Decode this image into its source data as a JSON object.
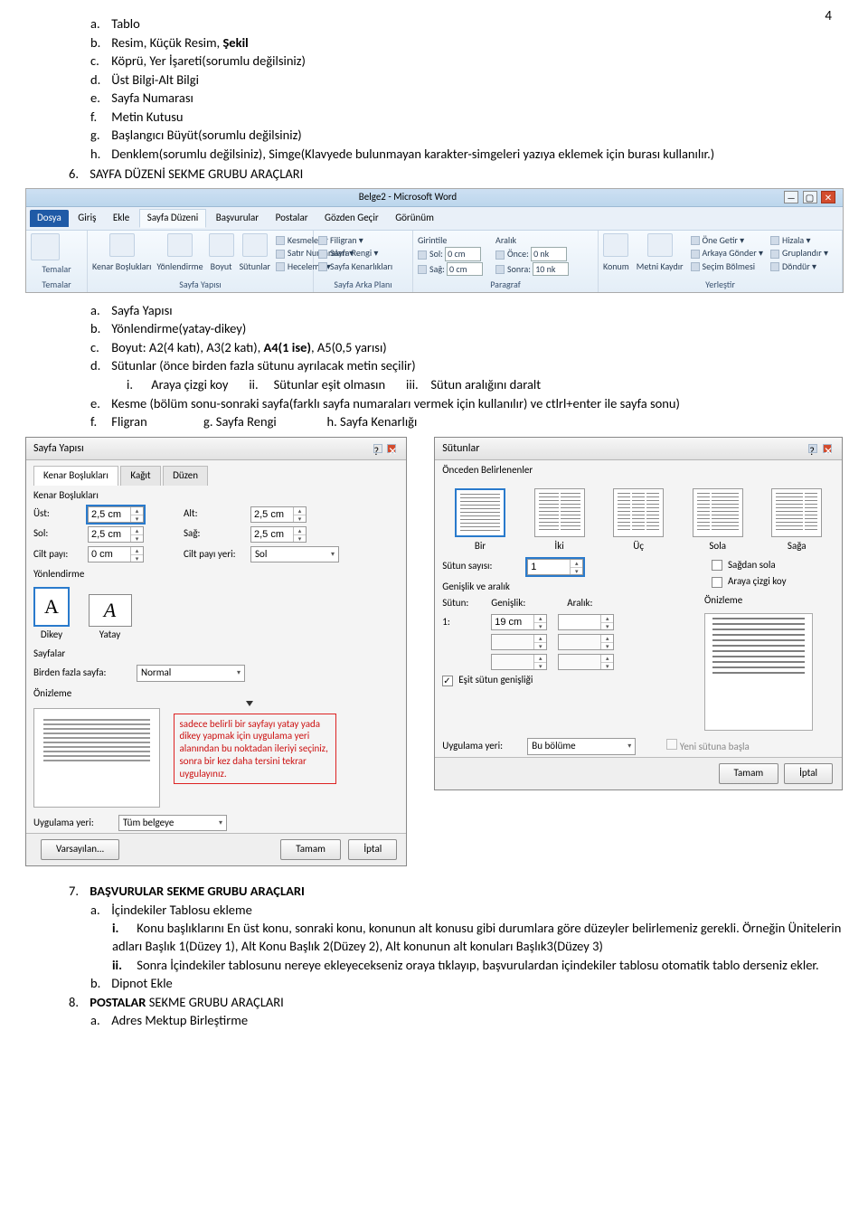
{
  "page_number": "4",
  "top": {
    "a": "Tablo",
    "b_prefix": "Resim, Küçük Resim, ",
    "b_bold": "Şekil",
    "c": "Köprü, Yer İşareti(sorumlu değilsiniz)",
    "d": "Üst Bilgi-Alt Bilgi",
    "e": "Sayfa Numarası",
    "f": "Metin Kutusu",
    "g": "Başlangıcı Büyüt(sorumlu değilsiniz)",
    "h": "Denklem(sorumlu değilsiniz), Simge(Klavyede bulunmayan karakter-simgeleri yazıya eklemek için burası kullanılır.)"
  },
  "sec6_prefix": "6.",
  "sec6_title": "SAYFA DÜZENİ SEKME GRUBU ARAÇLARI",
  "ribbon": {
    "win_title": "Belge2 - Microsoft Word",
    "tabs": {
      "file": "Dosya",
      "home": "Giriş",
      "insert": "Ekle",
      "layout": "Sayfa Düzeni",
      "refs": "Başvurular",
      "mail": "Postalar",
      "review": "Gözden Geçir",
      "view": "Görünüm"
    },
    "groups": {
      "temalar": {
        "lbl": "Temalar",
        "items": "Temalar"
      },
      "sayfa_yapisi": {
        "lbl": "Sayfa Yapısı",
        "kenar": "Kenar Boşlukları",
        "yonl": "Yönlendirme",
        "boyut": "Boyut",
        "sutun": "Sütunlar",
        "kesme": "Kesmeler",
        "satirno": "Satır Numaraları",
        "hece": "Heceleme"
      },
      "arka": {
        "lbl": "Sayfa Arka Planı",
        "filigran": "Filigran",
        "rengi": "Sayfa Rengi",
        "kenarlik": "Sayfa Kenarlıkları"
      },
      "paragraf": {
        "lbl": "Paragraf",
        "girinti": "Girintile",
        "aralik": "Aralık",
        "sol": "Sol:",
        "sag": "Sağ:",
        "once": "Önce:",
        "sonra": "Sonra:",
        "v0cm": "0 cm",
        "v0nk": "0 nk",
        "v10nk": "10 nk"
      },
      "yerlesir": {
        "lbl": "Yerleştir",
        "konum": "Konum",
        "metni": "Metni Kaydır",
        "one": "Öne Getir",
        "arkaya": "Arkaya Gönder",
        "secim": "Seçim Bölmesi",
        "hizala": "Hizala",
        "grup": "Gruplandır",
        "dondur": "Döndür"
      }
    }
  },
  "sec6_sub": {
    "a": "Sayfa Yapısı",
    "b": "Yönlendirme(yatay-dikey)",
    "c_pre": "Boyut: A2(4 katı), A3(2 katı), ",
    "c_bold": "A4(1 ise)",
    "c_post": ", A5(0,5 yarısı)",
    "d": "Sütunlar (önce birden fazla sütunu ayrılacak metin seçilir)",
    "di": "Araya çizgi koy",
    "dii": "Sütunlar eşit olmasın",
    "diii": "Sütun aralığını daralt",
    "e": "Kesme (bölüm sonu-sonraki sayfa(farklı sayfa numaraları vermek için kullanılır) ve ctlrl+enter ile sayfa sonu)",
    "f": "Fligran",
    "g": "g. Sayfa Rengi",
    "h": "h. Sayfa Kenarlığı"
  },
  "dlg1": {
    "title": "Sayfa Yapısı",
    "tab1": "Kenar Boşlukları",
    "tab2": "Kağıt",
    "tab3": "Düzen",
    "kb": "Kenar Boşlukları",
    "ust": "Üst:",
    "ust_v": "2,5 cm",
    "alt": "Alt:",
    "alt_v": "2,5 cm",
    "sol": "Sol:",
    "sol_v": "2,5 cm",
    "sag": "Sağ:",
    "sag_v": "2,5 cm",
    "cilt": "Cilt payı:",
    "cilt_v": "0 cm",
    "ciltyeri": "Cilt payı yeri:",
    "ciltyeri_v": "Sol",
    "yonl": "Yönlendirme",
    "dikey": "Dikey",
    "yatay": "Yatay",
    "sayfalar": "Sayfalar",
    "birden": "Birden fazla sayfa:",
    "birden_v": "Normal",
    "oniz": "Önizleme",
    "uygyeri": "Uygulama yeri:",
    "uygyeri_v": "Tüm belgeye",
    "vars": "Varsayılan...",
    "tamam": "Tamam",
    "iptal": "İptal",
    "red": "sadece belirli bir sayfayı yatay yada dikey yapmak için uygulama yeri alanından bu noktadan ileriyi seçiniz, sonra bir kez daha tersini tekrar uygulayınız."
  },
  "dlg2": {
    "title": "Sütunlar",
    "preset_hdr": "Önceden Belirlenenler",
    "p_bir": "Bir",
    "p_iki": "İki",
    "p_uc": "Üç",
    "p_sol": "Sola",
    "p_sag": "Sağa",
    "sutunsay": "Sütun sayısı:",
    "sutunsay_v": "1",
    "sagdan": "Sağdan sola",
    "araya": "Araya çizgi koy",
    "genhdr": "Genişlik ve aralık",
    "oniz": "Önizleme",
    "col_sutun": "Sütun:",
    "col_gen": "Genişlik:",
    "col_ara": "Aralık:",
    "r1_n": "1:",
    "r1_g": "19 cm",
    "esit": "Eşit sütun genişliği",
    "uygyeri": "Uygulama yeri:",
    "uygyeri_v": "Bu bölüme",
    "yenisutun": "Yeni sütuna başla",
    "tamam": "Tamam",
    "iptal": "İptal"
  },
  "sec7": {
    "n7": "7.",
    "t7": "BAŞVURULAR SEKME GRUBU ARAÇLARI",
    "a": "İçindekiler Tablosu ekleme",
    "i": "Konu başlıklarını En üst konu, sonraki konu, konunun alt konusu gibi durumlara göre düzeyler belirlemeniz gerekli. Örneğin Ünitelerin adları Başlık 1(Düzey 1), Alt Konu Başlık 2(Düzey 2), Alt konunun alt konuları Başlık3(Düzey 3)",
    "ii": "Sonra İçindekiler tablosunu nereye ekleyecekseniz oraya tıklayıp, başvurulardan içindekiler tablosu otomatik tablo derseniz ekler.",
    "b": "Dipnot Ekle",
    "n8": "8.",
    "t8_b": "POSTALAR",
    "t8_rest": "  SEKME GRUBU ARAÇLARI",
    "a8": "Adres Mektup Birleştirme"
  }
}
